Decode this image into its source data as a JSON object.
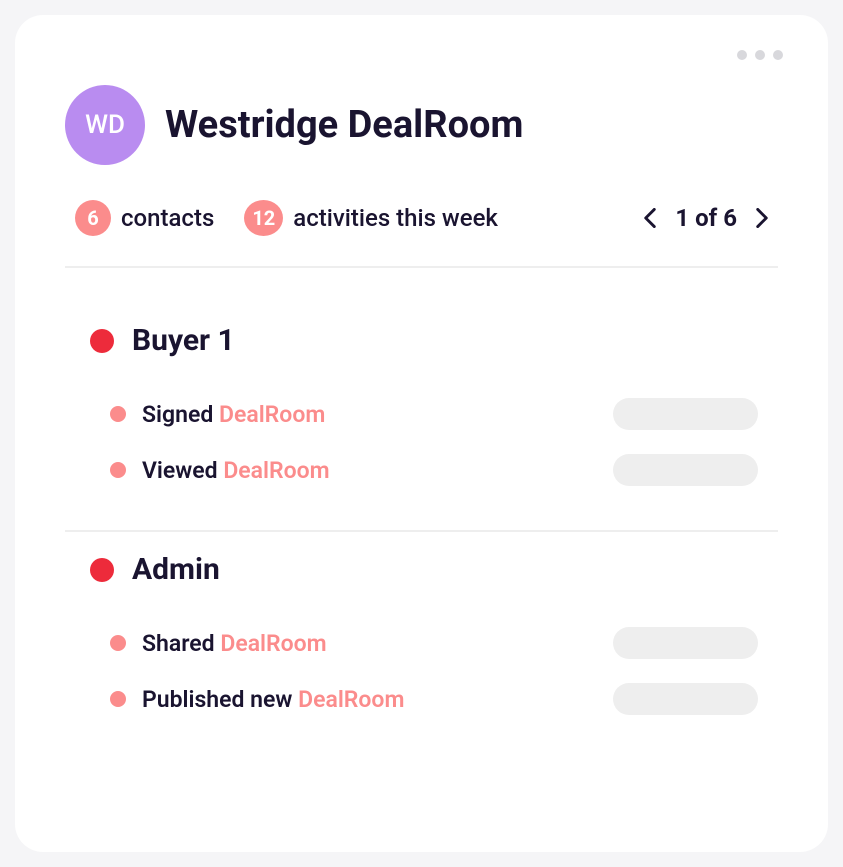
{
  "header": {
    "avatar_initials": "WD",
    "title": "Westridge DealRoom"
  },
  "stats": {
    "contacts_count": "6",
    "contacts_label": "contacts",
    "activities_count": "12",
    "activities_label": "activities this week"
  },
  "pager": {
    "text": "1 of 6"
  },
  "sections": [
    {
      "title": "Buyer 1",
      "activities": [
        {
          "action": "Signed",
          "object": "DealRoom"
        },
        {
          "action": "Viewed",
          "object": "DealRoom"
        }
      ]
    },
    {
      "title": "Admin",
      "activities": [
        {
          "action": "Shared",
          "object": "DealRoom"
        },
        {
          "action": "Published new",
          "object": "DealRoom"
        }
      ]
    }
  ]
}
